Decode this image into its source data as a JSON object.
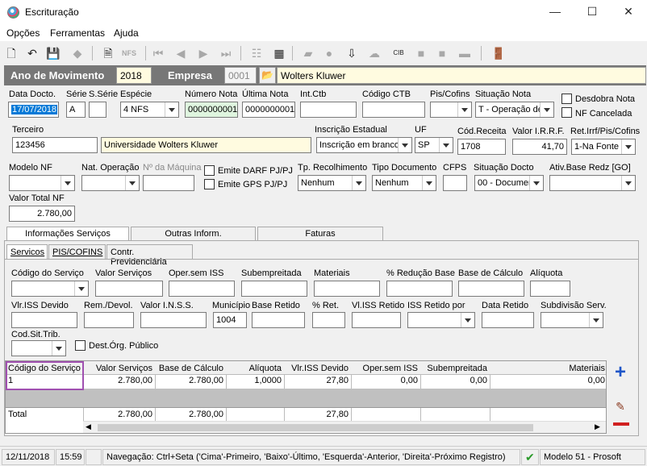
{
  "window": {
    "title": "Escrituração",
    "minimize": "—",
    "maximize": "☐",
    "close": "✕"
  },
  "menu": {
    "opcoes": "Opções",
    "ferramentas": "Ferramentas",
    "ajuda": "Ajuda"
  },
  "yearbar": {
    "ano_label": "Ano de Movimento",
    "ano_value": "2018",
    "empresa_label": "Empresa",
    "empresa_code": "0001",
    "empresa_name": "Wolters Kluwer"
  },
  "form": {
    "data_docto": {
      "label": "Data Docto.",
      "value": "17/07/2018"
    },
    "serie": {
      "label": "Série",
      "value": "A"
    },
    "sserie": {
      "label": "S.Série",
      "value": ""
    },
    "especie": {
      "label": "Espécie",
      "value": "4 NFS"
    },
    "numero_nota": {
      "label": "Número Nota",
      "value": "0000000001"
    },
    "ultima_nota": {
      "label": "Última Nota",
      "value": "0000000001"
    },
    "int_ctb": {
      "label": "Int.Ctb",
      "value": ""
    },
    "codigo_ctb": {
      "label": "Código CTB",
      "value": ""
    },
    "pis_cofins": {
      "label": "Pis/Cofins",
      "value": ""
    },
    "situacao_nota": {
      "label": "Situação Nota",
      "value": "T - Operação de"
    },
    "desdobra_nota": "Desdobra Nota",
    "nf_cancelada": "NF Cancelada",
    "terceiro": {
      "label": "Terceiro",
      "code": "123456",
      "name": "Universidade Wolters Kluwer"
    },
    "inscricao_estadual": {
      "label": "Inscrição Estadual",
      "value": "Inscrição em branco"
    },
    "uf": {
      "label": "UF",
      "value": "SP"
    },
    "cod_receita": {
      "label": "Cód.Receita",
      "value": "1708"
    },
    "valor_irrf": {
      "label": "Valor I.R.R.F.",
      "value": "41,70"
    },
    "ret_irrf": {
      "label": "Ret.Irrf/Pis/Cofins",
      "value": "1-Na Fonte"
    },
    "modelo_nf": {
      "label": "Modelo NF",
      "value": ""
    },
    "nat_operacao": {
      "label": "Nat. Operação",
      "value": ""
    },
    "n_maquina": {
      "label": "Nº da Máquina",
      "value": ""
    },
    "emite_darf": "Emite DARF PJ/PJ",
    "emite_gps": "Emite GPS PJ/PJ",
    "tp_recolhimento": {
      "label": "Tp. Recolhimento",
      "value": "Nenhum"
    },
    "tipo_documento": {
      "label": "Tipo Documento",
      "value": "Nenhum"
    },
    "cfps": {
      "label": "CFPS",
      "value": ""
    },
    "situacao_docto": {
      "label": "Situação Docto",
      "value": "00 - Documen"
    },
    "ativ_base": {
      "label": "Ativ.Base Redz [GO]",
      "value": ""
    },
    "valor_total_nf": {
      "label": "Valor Total NF",
      "value": "2.780,00"
    }
  },
  "tabs": [
    "Informações Serviços",
    "Outras Inform.",
    "Faturas"
  ],
  "subtabs": [
    "Servicos",
    "PIS/COFINS",
    "Contr. Previdenciária"
  ],
  "servicos": {
    "codigo_servico": "Código do Serviço",
    "valor_servicos": "Valor Serviços",
    "oper_sem_iss": "Oper.sem ISS",
    "subempreitada": "Subempreitada",
    "materiais": "Materiais",
    "reducao_base": "% Redução Base",
    "base_calculo": "Base de Cálculo",
    "aliquota": "Alíquota",
    "vlr_iss_devido": "Vlr.ISS Devido",
    "rem_devol": "Rem./Devol.",
    "valor_inss": "Valor I.N.S.S.",
    "municipio": "Município",
    "municipio_value": "1004",
    "base_retido": "Base Retido",
    "pct_ret": "% Ret.",
    "vl_iss_retido": "Vl.ISS Retido",
    "iss_retido_por": "ISS Retido por",
    "data_retido": "Data Retido",
    "subdivisao_serv": "Subdivisão Serv.",
    "cod_sit_trib": "Cod.Sit.Trib.",
    "dest_org_publico": "Dest.Órg. Público"
  },
  "grid": {
    "headers": [
      "Código do Serviço",
      "Valor Serviços",
      "Base de Cálculo",
      "Alíquota",
      "Vlr.ISS Devido",
      "Oper.sem ISS",
      "Subempreitada",
      "Materiais"
    ],
    "row": [
      "1",
      "2.780,00",
      "2.780,00",
      "1,0000",
      "27,80",
      "0,00",
      "0,00",
      "0,00"
    ],
    "total": [
      "Total",
      "2.780,00",
      "2.780,00",
      "",
      "27,80",
      "",
      "",
      ""
    ]
  },
  "status": {
    "date": "12/11/2018",
    "time": "15:59",
    "nav": "Navegação: Ctrl+Seta ('Cima'-Primeiro, 'Baixo'-Último, 'Esquerda'-Anterior, 'Direita'-Próximo Registro)",
    "model": "Modelo 51 - Prosoft"
  },
  "colors": {
    "accent": "#0078d7",
    "highlight_border": "#a050b0",
    "add": "#1e56c8",
    "remove": "#d02020"
  }
}
